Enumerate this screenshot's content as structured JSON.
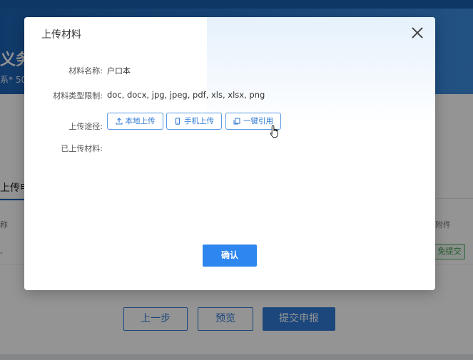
{
  "background": {
    "page_title_fragment": "义务",
    "page_sub_fragment": "系* 50",
    "tab_fragment": "上传电",
    "col_left": "称",
    "col_right": "附件",
    "row_left": "-",
    "badge": "免提交",
    "buttons": {
      "prev": "上一步",
      "preview": "预览",
      "submit": "提交申报"
    }
  },
  "modal": {
    "title": "上传材料",
    "close_icon": "close-icon",
    "fields": {
      "name_label": "材料名称:",
      "name_value": "户口本",
      "type_label": "材料类型限制:",
      "type_value": "doc, docx, jpg, jpeg, pdf, xls, xlsx, png",
      "path_label": "上传途径:",
      "uploaded_label": "已上传材料:"
    },
    "upload_buttons": {
      "local": "本地上传",
      "mobile": "手机上传",
      "quote": "一键引用"
    },
    "icons": {
      "local": "upload-icon",
      "mobile": "phone-icon",
      "quote": "copy-icon"
    },
    "confirm": "确认"
  },
  "colors": {
    "primary": "#2f7ad6",
    "confirm": "#2e86ef",
    "success": "#3a9a4d"
  }
}
